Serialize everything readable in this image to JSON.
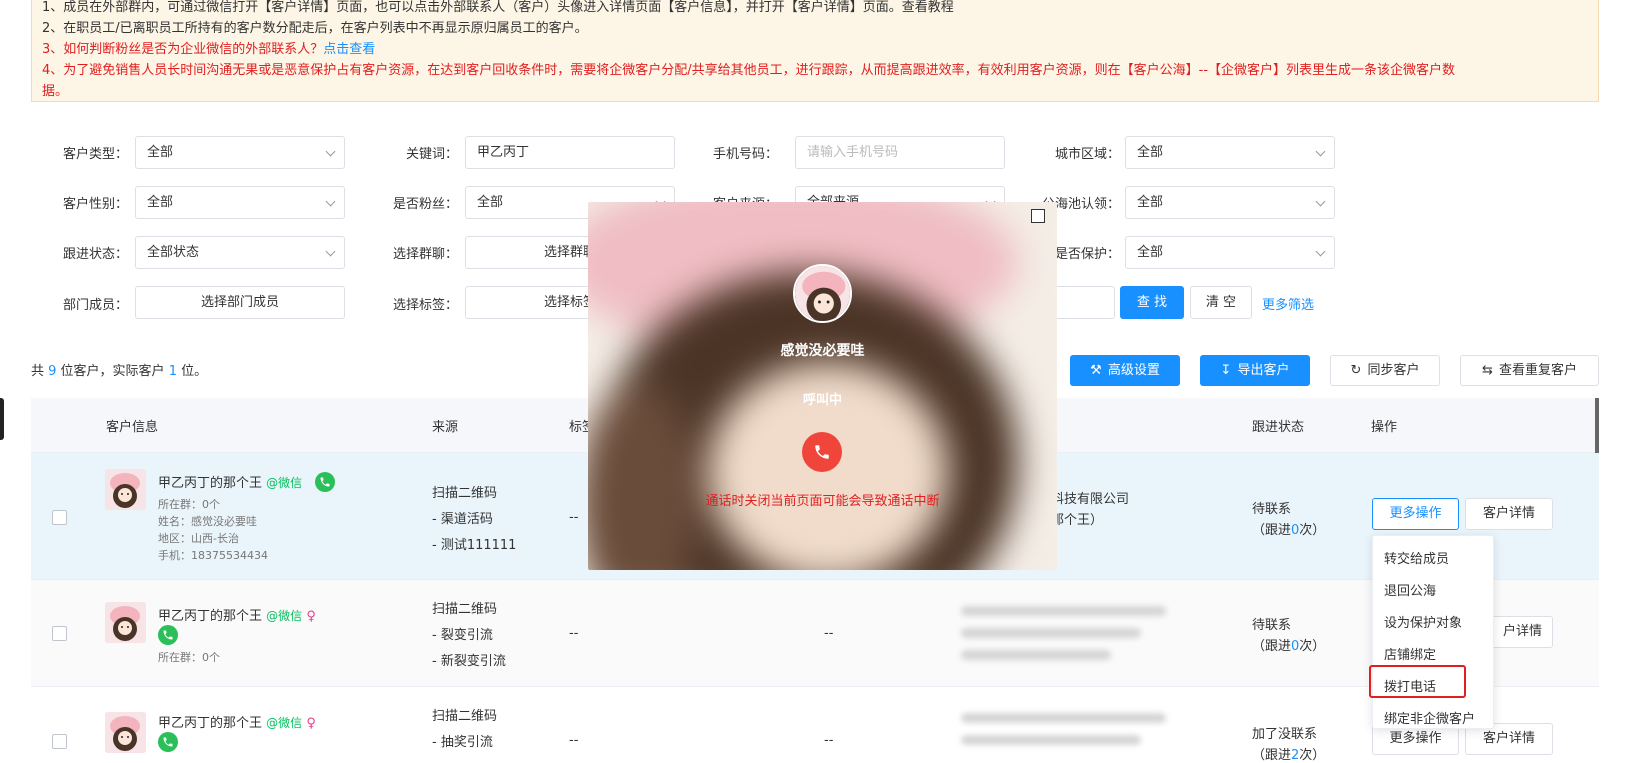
{
  "notice": {
    "line1": "1、成员在外部群内，可通过微信打开【客户详情】页面，也可以点击外部联系人（客户）头像进入详情页面【客户信息】，并打开【客户详情】页面。查看教程",
    "line2": "2、在职员工/已离职员工所持有的客户数分配走后，在客户列表中不再显示原归属员工的客户。",
    "line3_text": "3、如何判断粉丝是否为企业微信的外部联系人？",
    "line3_link": "点击查看",
    "line4": "4、为了避免销售人员长时间沟通无果或是恶意保护占有客户资源，在达到客户回收条件时，需要将企微客户分配/共享给其他员工，进行跟踪，从而提高跟进效率，有效利用客户资源，则在【客户公海】--【企微客户】列表里生成一条该企微客户数",
    "line4b": "据。"
  },
  "filters": {
    "customer_type_label": "客户类型：",
    "customer_type_value": "全部",
    "keyword_label": "关键词：",
    "keyword_value": "甲乙丙丁",
    "mobile_label": "手机号码：",
    "mobile_placeholder": "请输入手机号码",
    "city_label": "城市区域：",
    "city_value": "全部",
    "gender_label": "客户性别：",
    "gender_value": "全部",
    "is_fan_label": "是否粉丝：",
    "is_fan_value": "全部",
    "source_label": "客户来源：",
    "source_value": "全部来源",
    "sea_label": "公海池认领：",
    "sea_value": "全部",
    "follow_label": "跟进状态：",
    "follow_value": "全部状态",
    "group_label": "选择群聊：",
    "group_value": "选择群聊",
    "protect_label": "是否保护：",
    "protect_value": "全部",
    "dept_label": "部门成员：",
    "dept_value": "选择部门成员",
    "tag_label": "选择标签：",
    "tag_value": "选择标签",
    "search_btn": "查 找",
    "clear_btn": "清 空",
    "more_filter": "更多筛选"
  },
  "summary": {
    "prefix": "共 ",
    "total": "9",
    "mid": " 位客户，实际客户 ",
    "actual": "1",
    "suffix": " 位。"
  },
  "toolbar": {
    "advanced": "高级设置",
    "export": "导出客户",
    "sync": "同步客户",
    "duplicates": "查看重复客户"
  },
  "table": {
    "headers": {
      "info": "客户信息",
      "source": "来源",
      "tag": "标签",
      "follow": "跟进状态",
      "action": "操作"
    },
    "rows": [
      {
        "name": "甲乙丙丁的那个王",
        "wechat": "@微信",
        "group": "所在群：0个",
        "real_name": "姓名：感觉没必要哇",
        "region": "地区：山西-长治",
        "phone": "手机：18375534434",
        "source1": "扫描二维码",
        "source2": "- 渠道活码",
        "source3": "- 测试111111",
        "tag": "--",
        "company1": "科技有限公司",
        "company2": "那个王）",
        "company3": "）",
        "status": "待联系",
        "follow_prefix": "（跟进",
        "follow_count": "0",
        "follow_suffix": "次）",
        "more_btn": "更多操作",
        "detail_btn": "客户详情"
      },
      {
        "name": "甲乙丙丁的那个王",
        "wechat": "@微信",
        "gender": "♀",
        "group": "所在群：0个",
        "source1": "扫描二维码",
        "source2": "- 裂变引流",
        "source3": "- 新裂变引流",
        "tag": "--",
        "mid": "--",
        "status": "待联系",
        "follow_prefix": "（跟进",
        "follow_count": "0",
        "follow_suffix": "次）",
        "detail_btn": "户详情"
      },
      {
        "name": "甲乙丙丁的那个王",
        "wechat": "@微信",
        "gender": "♀",
        "source1": "扫描二维码",
        "source2": "- 抽奖引流",
        "tag": "--",
        "mid": "--",
        "status": "加了没联系",
        "follow_prefix": "（跟进",
        "follow_count": "2",
        "follow_suffix": "次）",
        "more_btn": "更多操作",
        "detail_btn": "客户详情"
      }
    ]
  },
  "dropdown": {
    "items": [
      "转交给成员",
      "退回公海",
      "设为保护对象",
      "店铺绑定",
      "拨打电话",
      "绑定非企微客户"
    ]
  },
  "call_modal": {
    "nickname": "感觉没必要哇",
    "status": "呼叫中",
    "warning": "通话时关闭当前页面可能会导致通话中断"
  },
  "colors": {
    "primary": "#1890ff",
    "danger": "#e02020",
    "wechat": "#07c160",
    "hangup": "#f0453b"
  }
}
